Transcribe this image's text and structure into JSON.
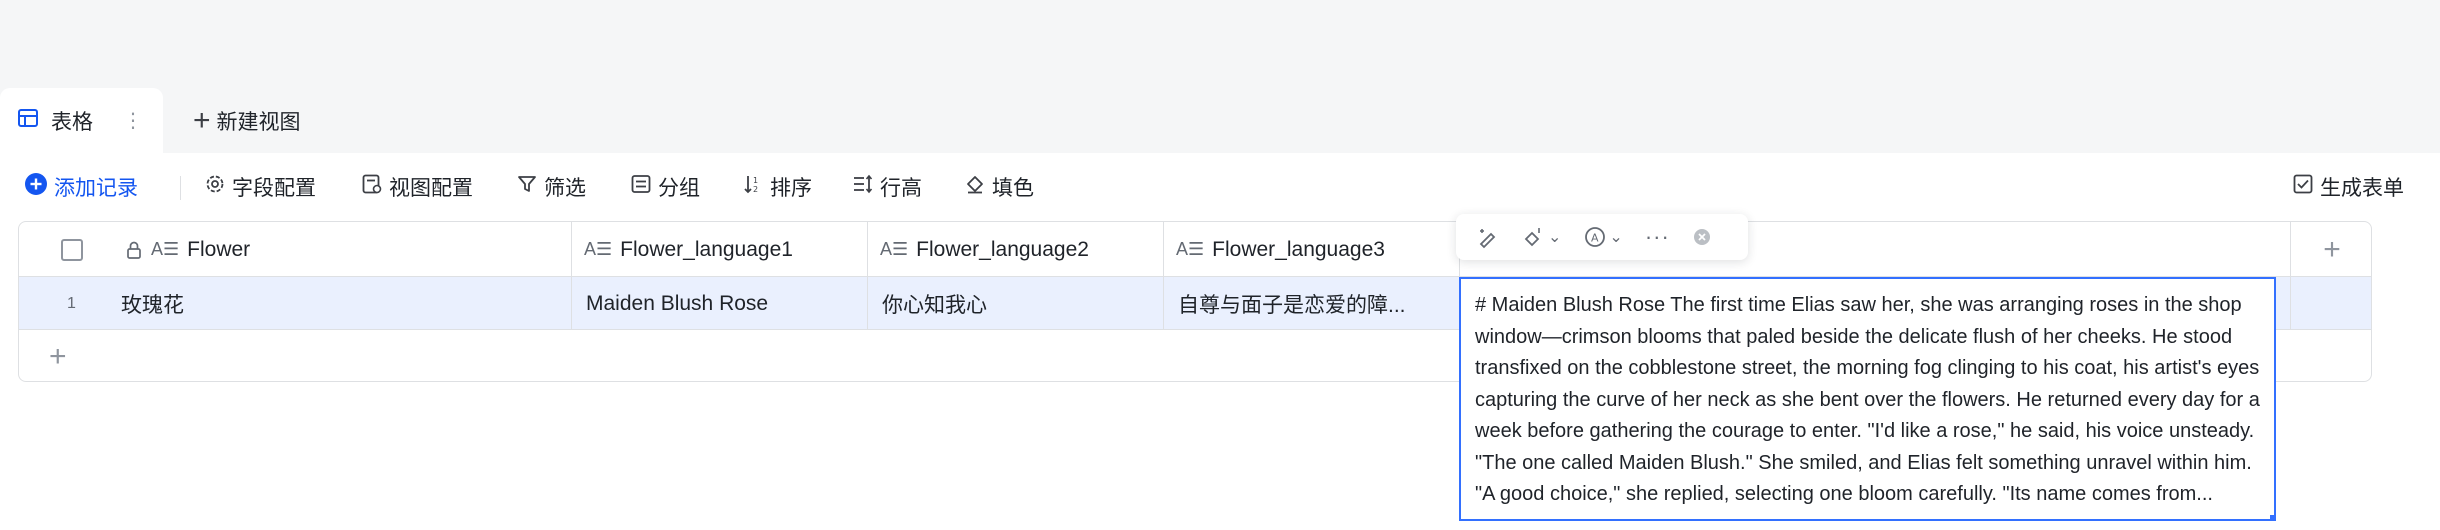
{
  "tabs": {
    "active_label": "表格",
    "more_label": "⋮",
    "new_view_label": "新建视图"
  },
  "toolbar": {
    "add_record": "添加记录",
    "field_config": "字段配置",
    "view_config": "视图配置",
    "filter": "筛选",
    "group": "分组",
    "sort": "排序",
    "row_height": "行高",
    "fill_color": "填色",
    "generate_form": "生成表单"
  },
  "table": {
    "columns": [
      "Flower",
      "Flower_language1",
      "Flower_language2",
      "Flower_language3"
    ],
    "rows": [
      {
        "index": "1",
        "flower": "玫瑰花",
        "flower_language1": "Maiden Blush Rose",
        "flower_language2": "你心知我心",
        "flower_language3": "自尊与面子是恋爱的障..."
      }
    ]
  },
  "editor": {
    "text": "# Maiden Blush Rose The first time Elias saw her, she was arranging roses in the shop window—crimson blooms that paled beside the delicate flush of her cheeks. He stood transfixed on the cobblestone street, the morning fog clinging to his coat, his artist's eyes capturing the curve of her neck as she bent over the flowers. He returned every day for a week before gathering the courage to enter. \"I'd like a rose,\" he said, his voice unsteady. \"The one called Maiden Blush.\" She smiled, and Elias felt something unravel within him. \"A good choice,\" she replied, selecting one bloom carefully. \"Its name comes from..."
  },
  "colors": {
    "accent": "#1456f0",
    "selection_border": "#3370ff",
    "row_highlight": "#eaf0fe",
    "top_band": "#f5f6f7"
  },
  "icons": {
    "tab": "table-icon",
    "add": "plus-circle-icon",
    "field_config": "gear-icon",
    "view_config": "view-settings-icon",
    "filter": "filter-icon",
    "group": "group-icon",
    "sort": "sort-icon",
    "row_height": "row-height-icon",
    "fill": "paint-bucket-icon",
    "ai": "ai-ring-icon",
    "history": "history-icon",
    "form": "form-icon"
  }
}
